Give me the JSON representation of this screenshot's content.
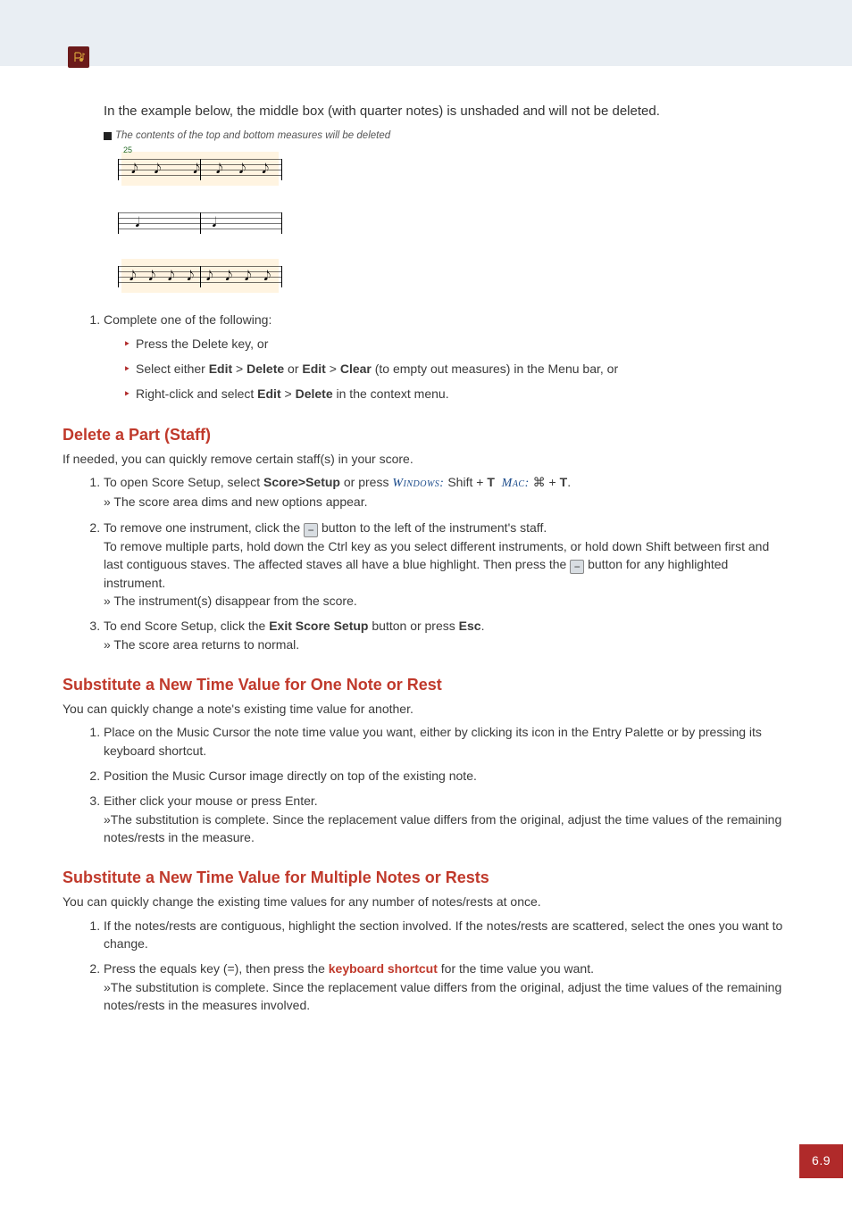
{
  "intro": {
    "lead": "In the example below, the middle box (with quarter notes) is unshaded and will not be deleted.",
    "caption": "The contents of the top and bottom measures will be deleted",
    "measure_number": "25"
  },
  "example_steps": {
    "step1": "Complete one of the following:",
    "bullets": {
      "a": "Press the Delete key, or",
      "b_pre": "Select either ",
      "b_edit": "Edit",
      "b_gt": " > ",
      "b_del": "Delete",
      "b_or": " or ",
      "b_clear": "Clear",
      "b_post": " (to empty out measures) in the Menu bar, or",
      "c_pre": "Right-click and select ",
      "c_post": " in the context menu."
    }
  },
  "h_delete_part": "Delete a Part (Staff)",
  "delete_part": {
    "intro": "If needed, you can quickly remove certain staff(s) in your score.",
    "s1_pre": "To open Score Setup, select ",
    "s1_b": "Score>Setup",
    "s1_mid": " or press ",
    "os_win": "Windows:",
    "s1_win": " Shift + ",
    "s1_T": "T",
    "os_mac": "Mac:",
    "s1_mac": " ⌘ + ",
    "s1_dot": ".",
    "s1_result": "» The score area dims and new options appear.",
    "s2_a": "To remove one instrument, click the ",
    "s2_b": " button to the left of the instrument's staff.",
    "s2_c": "To remove multiple parts, hold down the Ctrl key as you select different instruments, or hold down Shift between first and last contiguous staves. The affected staves all have a blue highlight. Then press the ",
    "s2_d": " button for any highlighted instrument.",
    "s2_result": "» The instrument(s) disappear from the score.",
    "s3_pre": "To end Score Setup, click the ",
    "s3_b": "Exit Score Setup",
    "s3_mid": " button or press ",
    "s3_esc": "Esc",
    "s3_dot": ".",
    "s3_result": "» The score area returns to normal."
  },
  "h_sub_one": "Substitute a New Time Value for One Note or Rest",
  "sub_one": {
    "intro": "You can quickly change a note's existing time value for another.",
    "s1": "Place on the Music Cursor the note time value you want, either by clicking its icon in the Entry Palette or by pressing its keyboard shortcut.",
    "s2": "Position the Music Cursor image directly on top of the existing note.",
    "s3a": "Either click your mouse or press Enter.",
    "s3b": "»The substitution is complete. Since the replacement value differs from the original, adjust the time values of the remaining notes/rests in the measure."
  },
  "h_sub_multi": "Substitute a New Time Value for Multiple Notes or Rests",
  "sub_multi": {
    "intro": "You can quickly change the existing time values for any number of notes/rests at once.",
    "s1": "If the notes/rests are contiguous, highlight the section involved. If the notes/rests are scattered, select the ones you want to change.",
    "s2_pre": "Press the equals key (=), then press the ",
    "s2_link": "keyboard shortcut",
    "s2_post": " for the time value you want.",
    "s2_result": "»The substitution is complete. Since the replacement value differs from the original, adjust the time values of the remaining notes/rests in the measures involved."
  },
  "page_num": "6.9"
}
